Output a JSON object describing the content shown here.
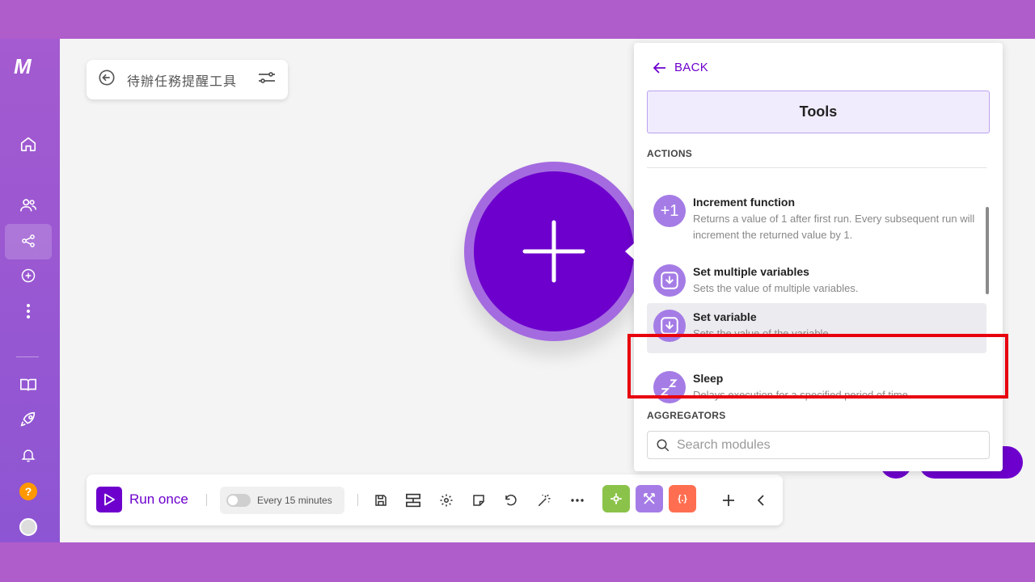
{
  "colors": {
    "accent": "#6d00cc",
    "module_icon": "#a57ce6",
    "highlight": "#e8000d"
  },
  "sidebar": {
    "logo": "M",
    "icons": [
      "home-icon",
      "team-icon",
      "scenarios-icon",
      "ai-icon",
      "more-icon",
      "docs-icon",
      "rocket-icon",
      "bell-icon",
      "help-icon",
      "avatar"
    ],
    "help_label": "?",
    "active": "scenarios-icon"
  },
  "scenario": {
    "name": "待辦任務提醒工具"
  },
  "toolbar": {
    "run_label": "Run once",
    "schedule_label": "Every 15 minutes",
    "icons": [
      "save-icon",
      "autoalign-icon",
      "settings-icon",
      "notes-icon",
      "undo-icon",
      "magic-icon",
      "more-icon"
    ],
    "color_buttons": [
      {
        "name": "tools-button",
        "color": "#8bc34a"
      },
      {
        "name": "flow-control-button",
        "color": "#a57ce6"
      },
      {
        "name": "text-parser-button",
        "color": "#ff6e50",
        "label": "{.}"
      }
    ]
  },
  "panel": {
    "back_label": "BACK",
    "title": "Tools",
    "section_actions": "ACTIONS",
    "section_aggregators": "AGGREGATORS",
    "items": [
      {
        "title": "Increment function",
        "desc": "Returns a value of 1 after first run. Every subsequent run will increment the returned value by 1.",
        "icon": "+1"
      },
      {
        "title": "Set multiple variables",
        "desc": "Sets the value of multiple variables."
      },
      {
        "title": "Set variable",
        "desc": "Sets the value of the variable."
      },
      {
        "title": "Sleep",
        "desc": "Delays execution for a specified period of time."
      }
    ],
    "search_placeholder": "Search modules"
  }
}
